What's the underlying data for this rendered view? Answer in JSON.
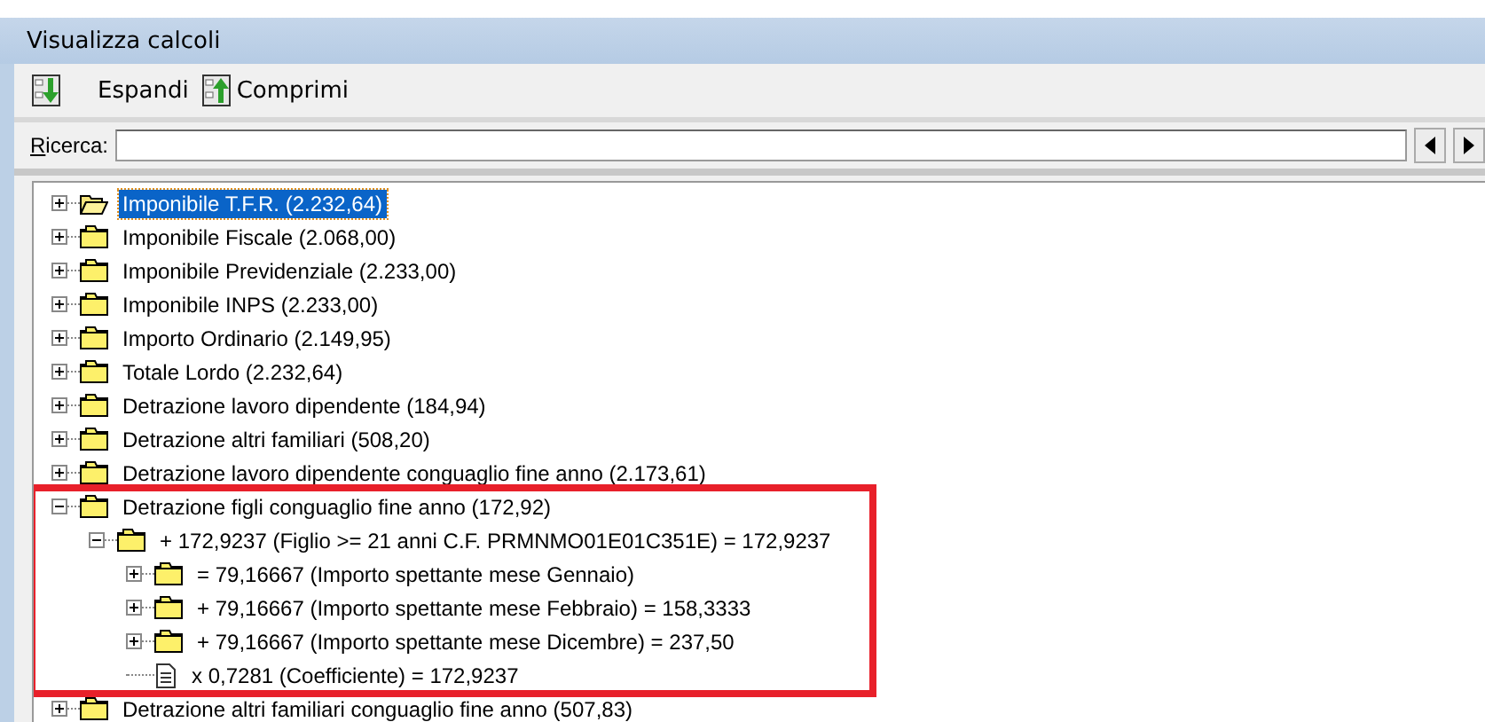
{
  "window": {
    "title": "Visualizza calcoli"
  },
  "toolbar": [
    {
      "kind": "expand",
      "label": "Espandi"
    },
    {
      "kind": "collapse",
      "label": "Comprimi"
    }
  ],
  "search": {
    "label": "Ricerca:"
  },
  "tree": [
    {
      "kind": "folder",
      "label": "Imponibile T.F.R. (2.232,64)",
      "selected": true,
      "expanded": false,
      "highlighted": false
    },
    {
      "kind": "folder",
      "label": "Imponibile Fiscale (2.068,00)",
      "selected": false,
      "expanded": false,
      "highlighted": false
    },
    {
      "kind": "folder",
      "label": "Imponibile Previdenziale (2.233,00)",
      "selected": false,
      "expanded": false,
      "highlighted": false
    },
    {
      "kind": "folder",
      "label": "Imponibile INPS (2.233,00)",
      "selected": false,
      "expanded": false,
      "highlighted": false
    },
    {
      "kind": "folder",
      "label": "Importo Ordinario (2.149,95)",
      "selected": false,
      "expanded": false,
      "highlighted": false
    },
    {
      "kind": "folder",
      "label": "Totale Lordo (2.232,64)",
      "selected": false,
      "expanded": false,
      "highlighted": false
    },
    {
      "kind": "folder",
      "label": "Detrazione lavoro dipendente (184,94)",
      "selected": false,
      "expanded": false,
      "highlighted": false
    },
    {
      "kind": "folder",
      "label": "Detrazione altri familiari (508,20)",
      "selected": false,
      "expanded": false,
      "highlighted": false
    },
    {
      "kind": "folder",
      "label": "Detrazione lavoro dipendente conguaglio fine anno (2.173,61)",
      "selected": false,
      "expanded": false,
      "highlighted": false
    },
    {
      "kind": "folder",
      "label": "Detrazione figli conguaglio fine anno (172,92)",
      "selected": false,
      "expanded": true,
      "highlighted": true,
      "children": [
        {
          "kind": "folder",
          "label": "+ 172,9237 (Figlio >= 21 anni C.F. PRMNMO01E01C351E) = 172,9237",
          "selected": false,
          "expanded": true,
          "highlighted": false,
          "children": [
            {
              "kind": "folder",
              "label": "= 79,16667 (Importo spettante mese Gennaio)",
              "selected": false,
              "expanded": false,
              "highlighted": false
            },
            {
              "kind": "folder",
              "label": "+ 79,16667 (Importo spettante mese Febbraio) = 158,3333",
              "selected": false,
              "expanded": false,
              "highlighted": false
            },
            {
              "kind": "folder",
              "label": "+ 79,16667 (Importo spettante mese Dicembre) = 237,50",
              "selected": false,
              "expanded": false,
              "highlighted": false
            },
            {
              "kind": "document",
              "label": "x 0,7281 (Coefficiente) = 172,9237",
              "selected": false,
              "highlighted": false
            }
          ]
        }
      ]
    },
    {
      "kind": "folder",
      "label": "Detrazione altri familiari conguaglio fine anno (507,83)",
      "selected": false,
      "expanded": false,
      "highlighted": false
    }
  ]
}
